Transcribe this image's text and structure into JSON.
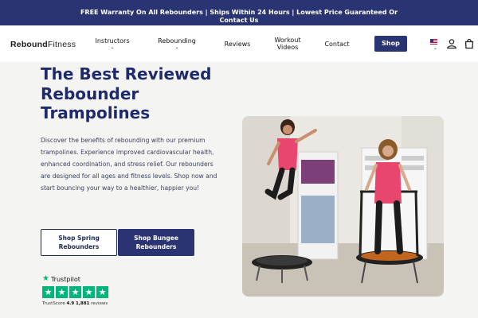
{
  "announcement": "FREE Warranty On All Rebounders | Ships Within 24 Hours | Lowest Price Guaranteed Or Contact Us",
  "logo": {
    "bold": "Rebound",
    "light": "Fitness"
  },
  "nav": {
    "instructors": "Instructors",
    "rebounding": "Rebounding",
    "reviews": "Reviews",
    "workout_videos_line1": "Workout",
    "workout_videos_line2": "Videos",
    "contact": "Contact",
    "shop": "Shop",
    "chevron": "⌄"
  },
  "hero": {
    "title_line1": "The Best Reviewed",
    "title_line2": "Rebounder",
    "title_line3": "Trampolines",
    "description": "Discover the benefits of rebounding with our premium trampolines. Experience improved cardiovascular health, enhanced coordination, and stress relief. Our rebounders are designed for all ages and fitness levels. Shop now and start bouncing your way to a healthier, happier you!"
  },
  "buttons": {
    "spring_line1": "Shop Spring",
    "spring_line2": "Rebounders",
    "bungee_line1": "Shop Bungee",
    "bungee_line2": "Rebounders"
  },
  "trustpilot": {
    "brand": "Trustpilot",
    "score_label": "TrustScore",
    "score": "4.9",
    "reviews_count": "1,881",
    "reviews_label": "reviews",
    "rating": 5
  },
  "colors": {
    "brand_navy": "#2a3472",
    "trustpilot_green": "#00b67a",
    "shirt_pink": "#e8456f"
  },
  "icons": [
    "flag-icon",
    "user-icon",
    "shopping-bag-icon",
    "trustpilot-star-icon"
  ]
}
